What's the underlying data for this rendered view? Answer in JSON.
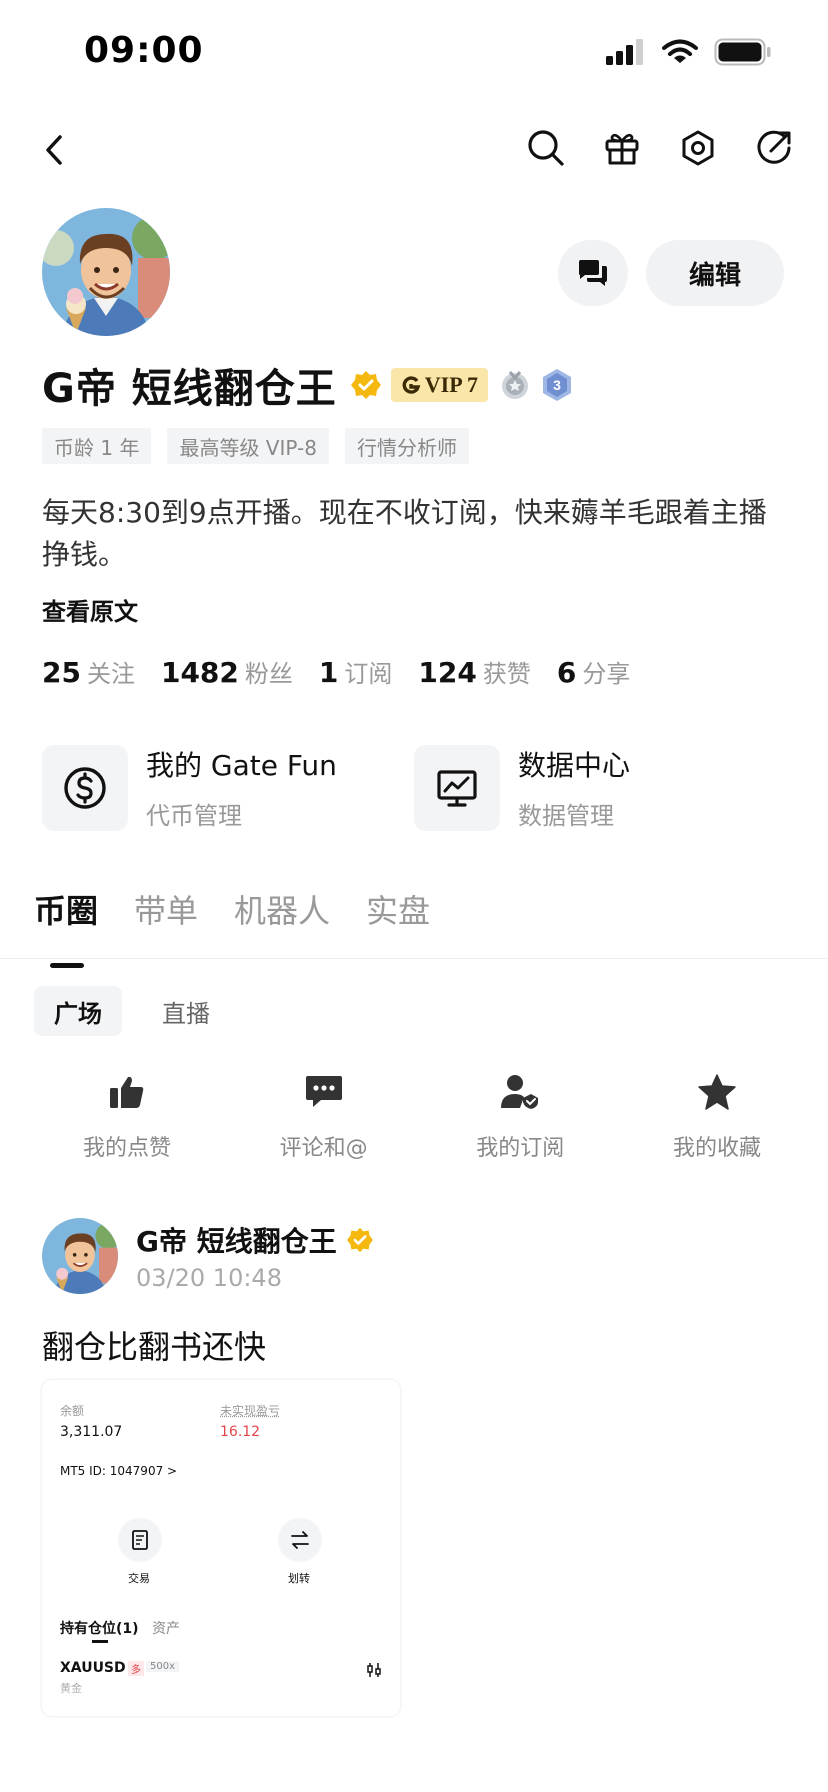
{
  "status": {
    "time": "09:00"
  },
  "profile": {
    "name": "G帝 短线翻仓王",
    "vip_label": "VIP 7",
    "medal_number": "3",
    "edit_label": "编辑",
    "tags": [
      "币龄 1 年",
      "最高等级 VIP-8",
      "行情分析师"
    ],
    "bio": "每天8:30到9点开播。现在不收订阅，快来薅羊毛跟着主播挣钱。",
    "view_original": "查看原文"
  },
  "stats": [
    {
      "num": "25",
      "label": "关注"
    },
    {
      "num": "1482",
      "label": "粉丝"
    },
    {
      "num": "1",
      "label": "订阅"
    },
    {
      "num": "124",
      "label": "获赞"
    },
    {
      "num": "6",
      "label": "分享"
    }
  ],
  "tools": [
    {
      "title": "我的 Gate Fun",
      "sub": "代币管理",
      "icon": "dollar-icon"
    },
    {
      "title": "数据中心",
      "sub": "数据管理",
      "icon": "monitor-chart-icon"
    }
  ],
  "main_tabs": [
    "币圈",
    "带单",
    "机器人",
    "实盘"
  ],
  "sub_tabs": [
    "广场",
    "直播"
  ],
  "quick_actions": [
    {
      "label": "我的点赞",
      "icon": "thumbs-up-icon"
    },
    {
      "label": "评论和@",
      "icon": "comment-icon"
    },
    {
      "label": "我的订阅",
      "icon": "user-check-icon"
    },
    {
      "label": "我的收藏",
      "icon": "star-icon"
    }
  ],
  "post": {
    "author": "G帝 短线翻仓王",
    "time": "03/20 10:48",
    "text": "翻仓比翻书还快",
    "image": {
      "balance_label": "余额",
      "balance_value": "3,311.07",
      "pnl_label": "未实现盈亏",
      "pnl_value": "16.12",
      "account_id": "MT5 ID: 1047907 >",
      "trade_label": "交易",
      "transfer_label": "划转",
      "positions_tab": "持有仓位(1)",
      "assets_tab": "资产",
      "symbol": "XAUUSD",
      "side": "多",
      "leverage": "500x",
      "symbol_sub": "黄金"
    }
  },
  "colors": {
    "accent_gold": "#f5b80f",
    "vip_bg": "#f9e6a8",
    "pnl_red": "#e2454b",
    "text_muted": "#999999"
  }
}
